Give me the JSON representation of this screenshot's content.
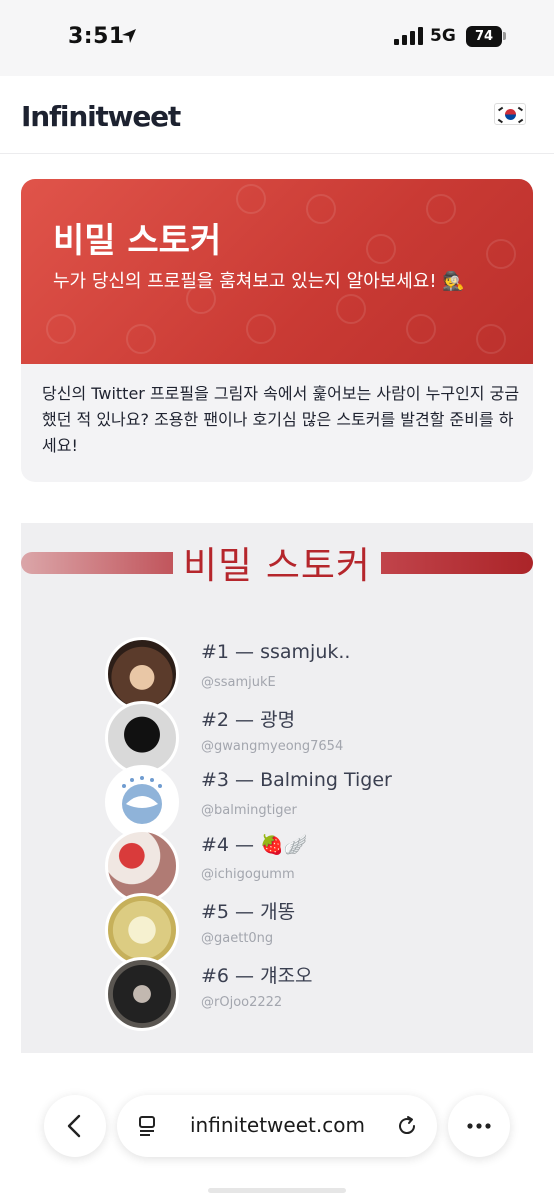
{
  "status_bar": {
    "time": "3:51",
    "network": "5G",
    "battery": "74"
  },
  "header": {
    "brand": "Infinitweet",
    "flag": "korea-flag-icon"
  },
  "promo": {
    "title": "비밀 스토커",
    "subtitle": "누가 당신의 프로필을 훔쳐보고 있는지 알아보세요! 🕵️",
    "body": "당신의 Twitter 프로필을 그림자 속에서 훑어보는 사람이 누구인지 궁금했던 적 있나요? 조용한 팬이나 호기심 많은 스토커를 발견할 준비를 하세요!"
  },
  "section": {
    "title": "비밀 스토커",
    "stalkers": [
      {
        "label": "#1 — ssamjuk..",
        "handle": "@ssamjukE"
      },
      {
        "label": "#2 — 광명",
        "handle": "@gwangmyeong7654"
      },
      {
        "label": "#3 — Balming Tiger",
        "handle": "@balmingtiger"
      },
      {
        "label": "#4 — 🍓🪽",
        "handle": "@ichigogumm"
      },
      {
        "label": "#5 — 개똥",
        "handle": "@gaett0ng"
      },
      {
        "label": "#6 — 걔조오",
        "handle": "@rOjoo2222"
      }
    ]
  },
  "browser": {
    "url": "infinitetweet.com"
  }
}
